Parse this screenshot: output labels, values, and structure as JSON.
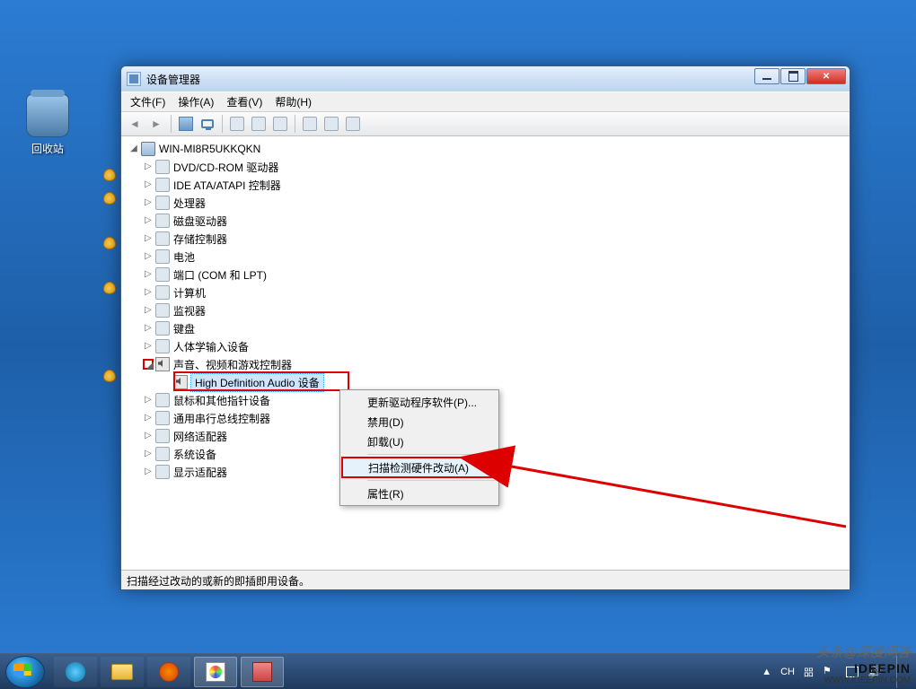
{
  "desktop": {
    "recycle_bin": "回收站"
  },
  "window": {
    "title": "设备管理器",
    "menus": {
      "file": "文件(F)",
      "action": "操作(A)",
      "view": "查看(V)",
      "help": "帮助(H)"
    }
  },
  "tree": {
    "root": "WIN-MI8R5UKKQKN",
    "items": [
      "DVD/CD-ROM 驱动器",
      "IDE ATA/ATAPI 控制器",
      "处理器",
      "磁盘驱动器",
      "存储控制器",
      "电池",
      "端口 (COM 和 LPT)",
      "计算机",
      "监视器",
      "键盘",
      "人体学输入设备"
    ],
    "sound_category": "声音、视频和游戏控制器",
    "sound_device": "High Definition Audio 设备",
    "after": [
      "鼠标和其他指针设备",
      "通用串行总线控制器",
      "网络适配器",
      "系统设备",
      "显示适配器"
    ]
  },
  "context_menu": {
    "update": "更新驱动程序软件(P)...",
    "disable": "禁用(D)",
    "uninstall": "卸载(U)",
    "scan": "扫描检测硬件改动(A)",
    "properties": "属性(R)"
  },
  "status_bar": "扫描经过改动的或新的即插即用设备。",
  "taskbar": {
    "lang": "CH",
    "ime": "㗊",
    "time_caret": "▲"
  },
  "watermark": {
    "line1": "头条@深度问答",
    "line2": "IDEEPIN",
    "line3": "WWW.IDEEPIN.COM"
  }
}
